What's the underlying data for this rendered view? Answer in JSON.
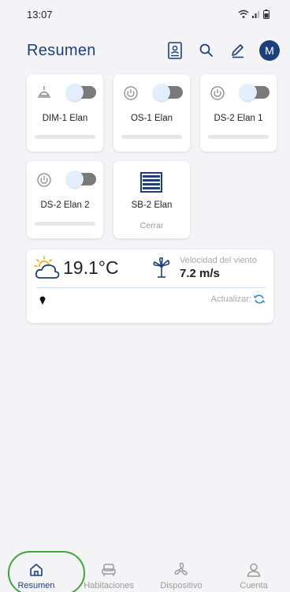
{
  "status_bar": {
    "time": "13:07"
  },
  "header": {
    "title": "Resumen",
    "avatar_initial": "M"
  },
  "devices": [
    {
      "name": "DIM-1 Elan",
      "icon": "lamp-icon",
      "type": "toggle",
      "on": false
    },
    {
      "name": "OS-1 Elan",
      "icon": "power-icon",
      "type": "toggle",
      "on": false
    },
    {
      "name": "DS-2 Elan 1",
      "icon": "power-icon",
      "type": "toggle",
      "on": false
    },
    {
      "name": "DS-2 Elan 2",
      "icon": "power-icon",
      "type": "toggle",
      "on": false
    },
    {
      "name": "SB-2 Elan",
      "icon": "blinds-icon",
      "type": "blind",
      "status": "Cerrar"
    }
  ],
  "weather": {
    "temperature": "19.1°C",
    "wind_label": "Velocidad del viento",
    "wind_value": "7.2 m/s",
    "update_label": "Actualizar:"
  },
  "nav": {
    "items": [
      {
        "label": "Resumen",
        "icon": "home-icon",
        "active": true
      },
      {
        "label": "Habitaciones",
        "icon": "sofa-icon",
        "active": false
      },
      {
        "label": "Dispositivo",
        "icon": "fan-icon",
        "active": false
      },
      {
        "label": "Cuenta",
        "icon": "user-icon",
        "active": false
      }
    ]
  },
  "colors": {
    "primary": "#1d3f7a",
    "highlight": "#3ea63a",
    "background": "#f4f4f6"
  }
}
